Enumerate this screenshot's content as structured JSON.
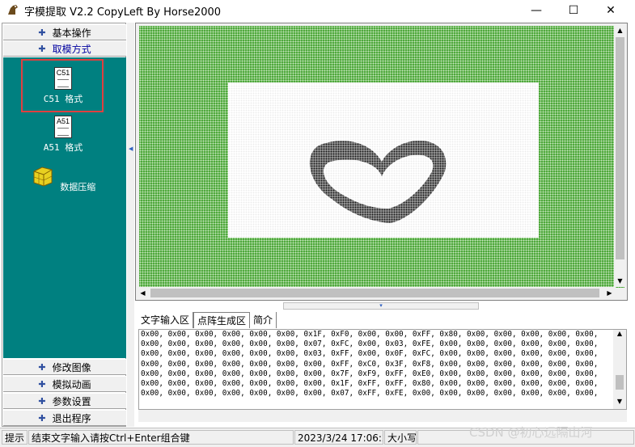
{
  "window": {
    "title": "字模提取 V2.2  CopyLeft By Horse2000",
    "minimize": "—",
    "maximize": "☐",
    "close": "✕"
  },
  "sidebar": {
    "top_items": [
      {
        "label": "基本操作"
      },
      {
        "label": "取模方式"
      }
    ],
    "tools": [
      {
        "label": "C51 格式",
        "icon_text": "C51",
        "icon": "c51-doc-icon"
      },
      {
        "label": "A51 格式",
        "icon_text": "A51",
        "icon": "a51-doc-icon"
      },
      {
        "label": "数据压缩",
        "icon": "compress-box-icon"
      }
    ],
    "bottom_items": [
      {
        "label": "修改图像"
      },
      {
        "label": "模拟动画"
      },
      {
        "label": "参数设置"
      },
      {
        "label": "退出程序"
      }
    ]
  },
  "tabs": [
    {
      "label": "文字输入区"
    },
    {
      "label": "点阵生成区",
      "active": true
    },
    {
      "label": "简介"
    }
  ],
  "output_lines": [
    "0x00, 0x00, 0x00, 0x00, 0x00, 0x00, 0x1F, 0xF0, 0x00, 0x00, 0xFF, 0x80, 0x00, 0x00, 0x00, 0x00, 0x00,",
    "0x00, 0x00, 0x00, 0x00, 0x00, 0x00, 0x07, 0xFC, 0x00, 0x03, 0xFE, 0x00, 0x00, 0x00, 0x00, 0x00, 0x00,",
    "0x00, 0x00, 0x00, 0x00, 0x00, 0x00, 0x03, 0xFF, 0x00, 0x0F, 0xFC, 0x00, 0x00, 0x00, 0x00, 0x00, 0x00,",
    "0x00, 0x00, 0x00, 0x00, 0x00, 0x00, 0x00, 0xFF, 0xC0, 0x3F, 0xF8, 0x00, 0x00, 0x00, 0x00, 0x00, 0x00,",
    "0x00, 0x00, 0x00, 0x00, 0x00, 0x00, 0x00, 0x7F, 0xF9, 0xFF, 0xE0, 0x00, 0x00, 0x00, 0x00, 0x00, 0x00,",
    "0x00, 0x00, 0x00, 0x00, 0x00, 0x00, 0x00, 0x1F, 0xFF, 0xFF, 0x80, 0x00, 0x00, 0x00, 0x00, 0x00, 0x00,",
    "0x00, 0x00, 0x00, 0x00, 0x00, 0x00, 0x00, 0x07, 0xFF, 0xFE, 0x00, 0x00, 0x00, 0x00, 0x00, 0x00, 0x00,"
  ],
  "status": {
    "prefix": "提示",
    "message": "结束文字输入请按Ctrl+Enter组合键",
    "datetime": "2023/3/24 17:06:20",
    "caps": "大小写",
    "watermark": "CSDN @初心远隔山河"
  },
  "colors": {
    "sidebar_bg": "#008080",
    "canvas_green": "#4fa83c",
    "highlight": "#e04040"
  }
}
